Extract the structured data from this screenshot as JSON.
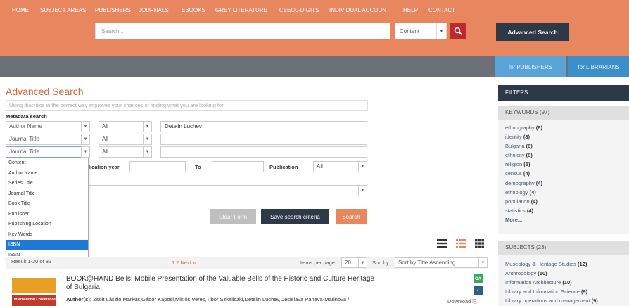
{
  "header": {
    "search_placeholder": "Search...",
    "content_select": "Content",
    "advanced_search_label": "Advanced Search"
  },
  "nav": {
    "items": [
      "HOME",
      "SUBJECT AREAS",
      "PUBLISHERS",
      "JOURNALS",
      "EBOOKS",
      "GREY LITERATURE",
      "CEEOL-DIGITS",
      "INDIVIDUAL ACCOUNT",
      "HELP",
      "CONTACT"
    ],
    "for_publishers": "for PUBLISHERS",
    "for_librarians": "for LIBRARIANS"
  },
  "advanced": {
    "title": "Advanced Search",
    "hint": "Using diacritics in the correct way improves your chances of finding what you are looking for.",
    "metadata_label": "Metadata search",
    "rows": [
      {
        "field": "Author Name",
        "op": "All",
        "value": "Detelin Luchev"
      },
      {
        "field": "Journal Title",
        "op": "All",
        "value": ""
      },
      {
        "field": "Journal Title",
        "op": "All",
        "value": ""
      }
    ],
    "publication_year_label": "lication year",
    "to_label": "To",
    "publication_label": "Publication",
    "publication_value": "All",
    "dropdown_options": [
      "Content",
      "Author Name",
      "Series Title",
      "Journal Title",
      "Book Title",
      "Publisher",
      "Publishing Location",
      "Key Words",
      "ISBN",
      "ISSN"
    ],
    "dropdown_selected_index": 8,
    "clear_label": "Clear Form",
    "save_label": "Save search criteria",
    "search_label": "Search"
  },
  "results": {
    "summary": "Result 1-20 of 33",
    "pagination": "1 2 Next »",
    "items_per_page_label": "Items per page:",
    "items_per_page": "20",
    "sort_label": "Sort by:",
    "sort_value": "Sort by Title Ascending",
    "article": {
      "title": "BOOK@HAND Bells: Mobile Presentation of the Valuable Bells of the Historic and Culture Heritage of Bulgaria",
      "authors_label": "Author(s):",
      "authors": "Zsolt László Márkus,Gábor Kaposi,Miklós Veres,Tibor Szkaliczki,Detelin Luchev,Desislava Paneva-Marinova /",
      "thumb_text": "International Conference",
      "oa": "OA",
      "download": "Download"
    }
  },
  "filters": {
    "title": "FILTERS",
    "keywords_title": "KEYWORDS (97)",
    "keywords": [
      {
        "label": "ethnography",
        "count": "(8)"
      },
      {
        "label": "identity",
        "count": "(8)"
      },
      {
        "label": "Bulgaria",
        "count": "(6)"
      },
      {
        "label": "ethnicity",
        "count": "(6)"
      },
      {
        "label": "religion",
        "count": "(5)"
      },
      {
        "label": "census",
        "count": "(4)"
      },
      {
        "label": "demography",
        "count": "(4)"
      },
      {
        "label": "ethnology",
        "count": "(4)"
      },
      {
        "label": "population",
        "count": "(4)"
      },
      {
        "label": "statistics",
        "count": "(4)"
      }
    ],
    "more": "More...",
    "subjects_title": "SUBJECTS (23)",
    "subjects": [
      {
        "label": "Museology & Heritage Studies",
        "count": "(12)"
      },
      {
        "label": "Anthropology",
        "count": "(10)"
      },
      {
        "label": "Information Architecture",
        "count": "(10)"
      },
      {
        "label": "Library and Information Science",
        "count": "(9)"
      },
      {
        "label": "Library operations and management",
        "count": "(9)"
      }
    ]
  }
}
